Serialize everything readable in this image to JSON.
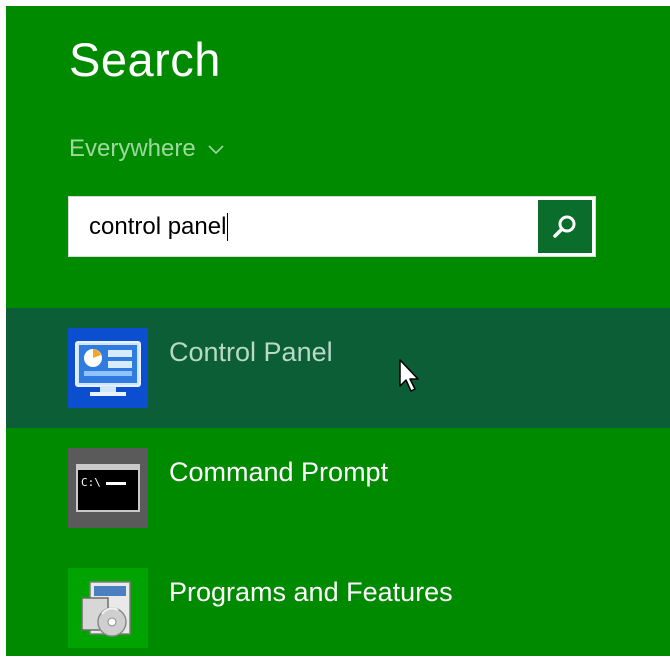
{
  "colors": {
    "background": "#008a00",
    "selected_row": "#0b5e36",
    "search_button": "#0b6d2b",
    "scope_text": "#9fd89f"
  },
  "header": {
    "title": "Search"
  },
  "scope": {
    "label": "Everywhere",
    "icon": "chevron-down-icon"
  },
  "search": {
    "value": "control panel",
    "button_icon": "magnifier-icon"
  },
  "results": [
    {
      "label": "Control Panel",
      "icon": "control-panel-icon",
      "selected": true
    },
    {
      "label": "Command Prompt",
      "icon": "command-prompt-icon",
      "selected": false
    },
    {
      "label": "Programs and Features",
      "icon": "programs-features-icon",
      "selected": false
    }
  ]
}
